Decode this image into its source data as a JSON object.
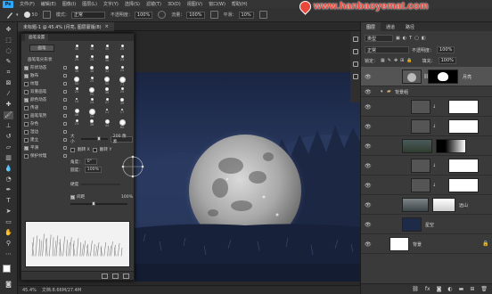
{
  "app": {
    "logo": "Ps"
  },
  "menu": [
    "文件(F)",
    "编辑(E)",
    "图像(I)",
    "图层(L)",
    "文字(Y)",
    "选择(S)",
    "滤镜(T)",
    "3D(D)",
    "视图(V)",
    "窗口(W)",
    "帮助(H)"
  ],
  "watermark": {
    "text": "www.hanbaoyemat.com"
  },
  "options": {
    "brush_size": "50",
    "mode_label": "模式：",
    "mode_value": "正常",
    "opacity_label": "不透明度：",
    "opacity_value": "100%",
    "flow_label": "流量：",
    "flow_value": "100%",
    "smoothing_label": "平滑：",
    "smoothing_value": "10%"
  },
  "document_tab": {
    "title": "未标题-1 @ 45.4% (月亮, 图层蒙版/8)",
    "close": "×"
  },
  "brush_panel": {
    "tab_label": "画笔设置",
    "presets_button": "画笔",
    "tip_shape_label": "画笔笔尖形状",
    "options": [
      {
        "label": "形状动态",
        "checked": true
      },
      {
        "label": "散布",
        "checked": true
      },
      {
        "label": "纹理",
        "checked": false
      },
      {
        "label": "双重画笔",
        "checked": false
      },
      {
        "label": "颜色动态",
        "checked": true
      },
      {
        "label": "传递",
        "checked": false
      },
      {
        "label": "画笔笔势",
        "checked": false
      },
      {
        "label": "杂色",
        "checked": false
      },
      {
        "label": "湿边",
        "checked": false
      },
      {
        "label": "建立",
        "checked": false
      },
      {
        "label": "平滑",
        "checked": true
      },
      {
        "label": "保护纹理",
        "checked": false
      }
    ],
    "tips": [
      "30",
      "30",
      "30",
      "25",
      "25",
      "25",
      "36",
      "25",
      "36",
      "36",
      "32",
      "25",
      "50",
      "25",
      "50",
      "71",
      "25",
      "50",
      "36",
      "25",
      "14",
      "24",
      "27",
      "39",
      "46",
      "59",
      "11",
      "17",
      "23",
      "36",
      "44",
      "60"
    ],
    "size_label": "大小",
    "size_value": "200 像素",
    "flip_x_label": "翻转 X",
    "flip_y_label": "翻转 Y",
    "angle_label": "角度：",
    "angle_value": "0°",
    "roundness_label": "圆度：",
    "roundness_value": "100%",
    "hardness_label": "硬度",
    "spacing_label": "间距",
    "spacing_value": "100%"
  },
  "status": {
    "zoom": "45.4%",
    "doc_info": "文档:8.66M/27.4M"
  },
  "layers_panel": {
    "tabs": [
      "图层",
      "通道",
      "路径"
    ],
    "kind_label": "类型",
    "blend_mode": "正常",
    "opacity_label": "不透明度：",
    "opacity_value": "100%",
    "lock_label": "锁定：",
    "fill_label": "填充：",
    "fill_value": "100%",
    "layers": [
      {
        "name": "月亮",
        "selected": true
      },
      {
        "name": "背景组",
        "group": true
      },
      {
        "name": "",
        "kind": "adjustment"
      },
      {
        "name": "",
        "kind": "adjustment"
      },
      {
        "name": "",
        "kind": "photo"
      },
      {
        "name": "",
        "kind": "adjustment"
      },
      {
        "name": "",
        "kind": "adjustment"
      },
      {
        "name": "远山",
        "kind": "photo"
      },
      {
        "name": "星空",
        "kind": "photo"
      },
      {
        "name": "背景",
        "kind": "fill"
      }
    ],
    "footer_icons": [
      "link-icon",
      "fx-icon",
      "mask-icon",
      "adjustment-icon",
      "group-icon",
      "new-layer-icon",
      "trash-icon"
    ]
  }
}
